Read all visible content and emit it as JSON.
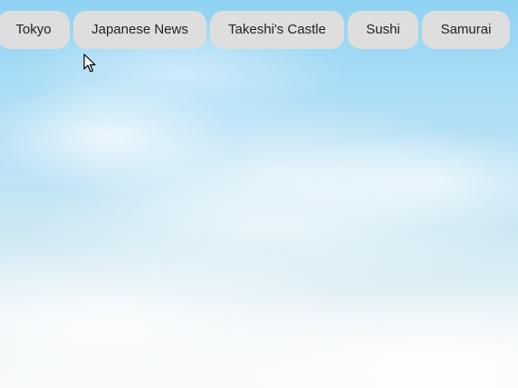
{
  "tabs": [
    {
      "label": "Tokyo"
    },
    {
      "label": "Japanese News"
    },
    {
      "label": "Takeshi's Castle"
    },
    {
      "label": "Sushi"
    },
    {
      "label": "Samurai"
    }
  ],
  "colors": {
    "tab_background": "#dedede",
    "tab_text": "#222222",
    "sky_top": "#8fd2f2",
    "sky_bottom": "#f7f9fa"
  },
  "icons": {
    "cursor": "mouse-pointer-icon"
  }
}
